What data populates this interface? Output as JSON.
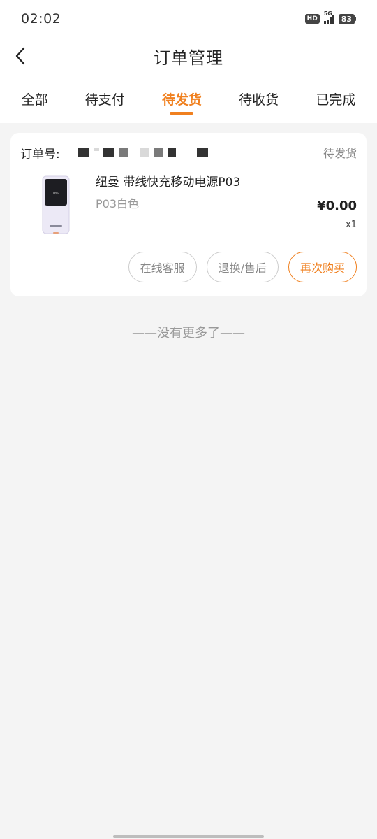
{
  "status_bar": {
    "time": "02:02",
    "hd_label": "HD",
    "network_label": "5G",
    "battery_level": "83"
  },
  "header": {
    "title": "订单管理"
  },
  "tabs": [
    {
      "label": "全部",
      "active": false
    },
    {
      "label": "待支付",
      "active": false
    },
    {
      "label": "待发货",
      "active": true
    },
    {
      "label": "待收货",
      "active": false
    },
    {
      "label": "已完成",
      "active": false
    }
  ],
  "order": {
    "number_label": "订单号:",
    "status": "待发货",
    "product": {
      "name": "纽曼 带线快充移动电源P03",
      "spec": "P03白色",
      "price": "¥0.00",
      "quantity": "x1"
    },
    "actions": {
      "service_label": "在线客服",
      "refund_label": "退换/售后",
      "rebuy_label": "再次购买"
    }
  },
  "footer_note": "——没有更多了——",
  "colors": {
    "accent": "#f0801f",
    "background": "#f4f4f4",
    "muted_text": "#999999"
  }
}
